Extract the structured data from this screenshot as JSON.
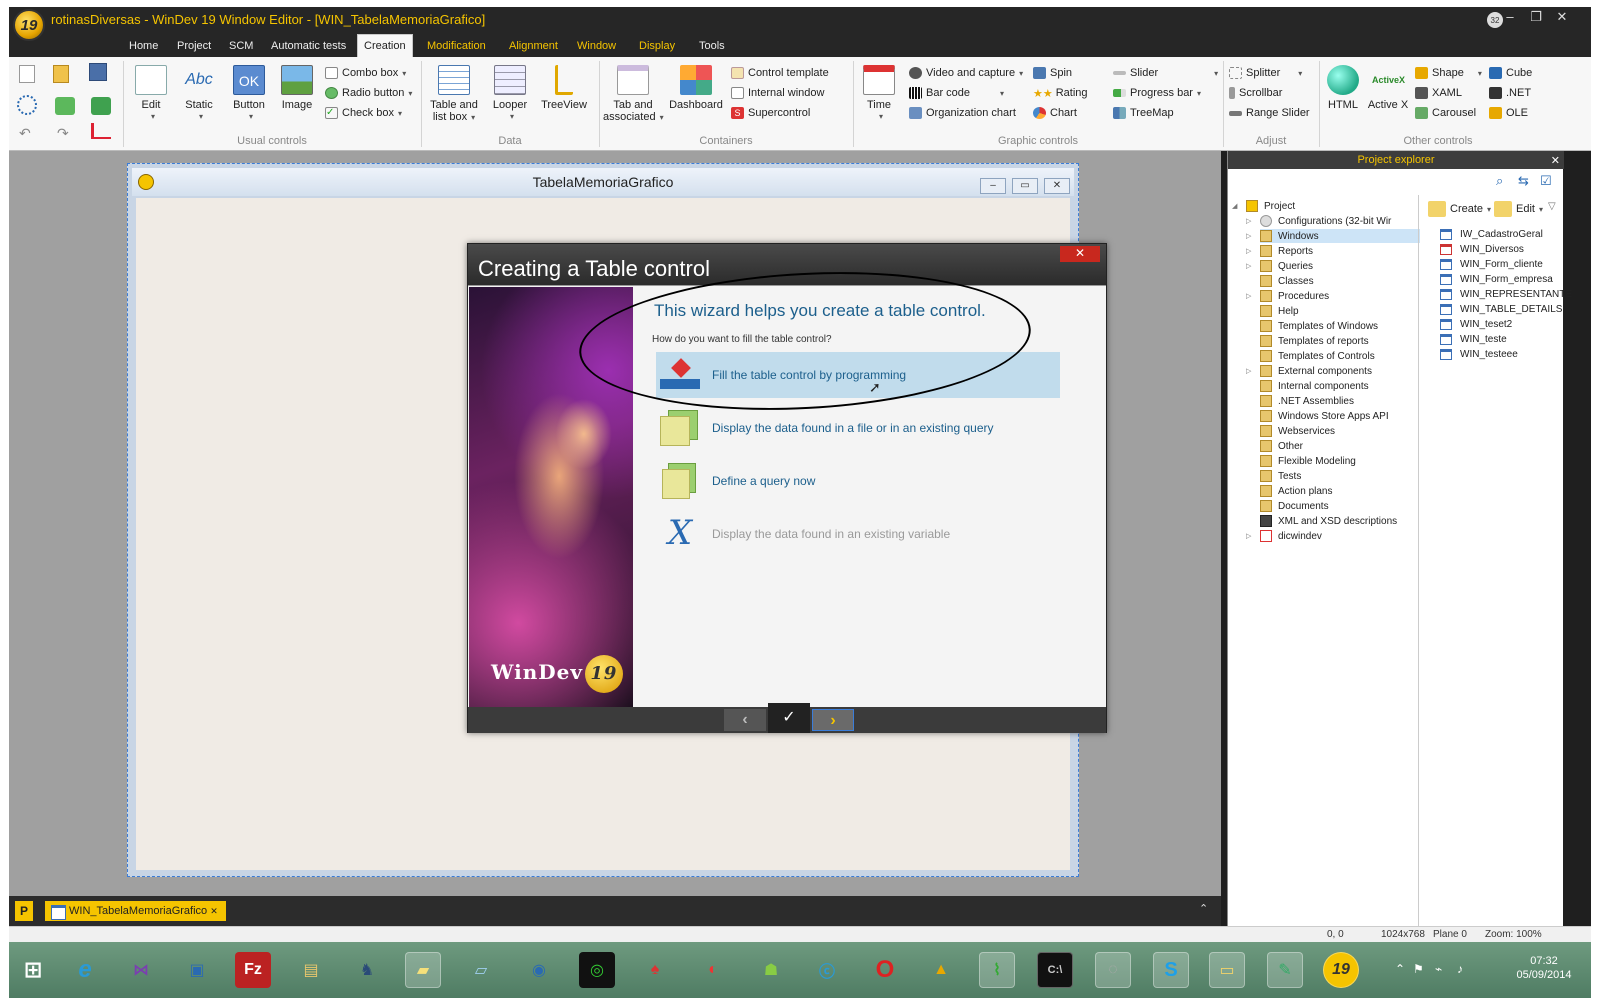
{
  "window": {
    "title": "rotinasDiversas - WinDev 19  Window Editor - [WIN_TabelaMemoriaGrafico]",
    "logo_text": "19",
    "badge": "32"
  },
  "menu": {
    "tabs": [
      "Home",
      "Project",
      "SCM",
      "Automatic tests",
      "Creation",
      "Modification",
      "Alignment",
      "Window",
      "Display",
      "Tools"
    ],
    "active": "Creation"
  },
  "ribbon": {
    "usual": {
      "label": "Usual controls",
      "edit": "Edit",
      "static": "Static",
      "button": "Button",
      "image": "Image",
      "combo": "Combo box",
      "radio": "Radio button",
      "check": "Check box",
      "static_icon_text": "Abc",
      "button_icon_text": "OK"
    },
    "data": {
      "label": "Data",
      "table_1": "Table and",
      "table_2": "list box",
      "looper": "Looper",
      "treeview": "TreeView"
    },
    "containers": {
      "label": "Containers",
      "tab_1": "Tab and",
      "tab_2": "associated",
      "dashboard": "Dashboard",
      "control_template": "Control template",
      "internal_window": "Internal window",
      "supercontrol": "Supercontrol"
    },
    "graphic": {
      "label": "Graphic controls",
      "time": "Time",
      "video": "Video and capture",
      "barcode": "Bar code",
      "org": "Organization chart",
      "spin": "Spin",
      "rating": "Rating",
      "chart": "Chart",
      "slider": "Slider",
      "progress": "Progress bar",
      "treemap": "TreeMap"
    },
    "adjust": {
      "label": "Adjust",
      "splitter": "Splitter",
      "scrollbar": "Scrollbar",
      "range": "Range Slider"
    },
    "other": {
      "label": "Other controls",
      "html": "HTML",
      "activex": "Active X",
      "activex_icon_text": "ActiveX",
      "shape": "Shape",
      "xaml": "XAML",
      "carousel": "Carousel",
      "cube": "Cube",
      "net": ".NET",
      "ole": "OLE"
    }
  },
  "design_window": {
    "title": "TabelaMemoriaGrafico"
  },
  "wizard": {
    "title": "Creating a Table control",
    "heading": "This wizard helps you create a table control.",
    "question": "How do you want to fill the table control?",
    "options": [
      {
        "label": "Fill the table control by programming",
        "selected": true
      },
      {
        "label": "Display the data found in a file or in an existing query",
        "selected": false
      },
      {
        "label": "Define a query now",
        "selected": false
      },
      {
        "label": "Display the data found in an existing variable",
        "selected": false,
        "disabled": true
      }
    ],
    "logo_text": "WinDev",
    "logo_number": "19",
    "back": "‹",
    "finish": "✓",
    "next": "›"
  },
  "explorer": {
    "title": "Project explorer",
    "tree": [
      "Project",
      "Configurations (32-bit Wir",
      "Windows",
      "Reports",
      "Queries",
      "Classes",
      "Procedures",
      "Help",
      "Templates of Windows",
      "Templates of reports",
      "Templates of Controls",
      "External components",
      "Internal components",
      ".NET Assemblies",
      "Windows Store Apps API",
      "Webservices",
      "Other",
      "Flexible Modeling",
      "Tests",
      "Action plans",
      "Documents",
      "XML and XSD descriptions",
      "dicwindev"
    ],
    "create": "Create",
    "edit": "Edit",
    "windows": [
      "IW_CadastroGeral",
      "WIN_Diversos",
      "WIN_Form_cliente",
      "WIN_Form_empresa",
      "WIN_REPRESENTANTE",
      "WIN_TABLE_DETAILS",
      "WIN_teset2",
      "WIN_teste",
      "WIN_testeee"
    ]
  },
  "docbar": {
    "tab": "WIN_TabelaMemoriaGrafico",
    "p_label": "P"
  },
  "status": {
    "coords": "0, 0",
    "resolution": "1024x768",
    "plane": "Plane 0",
    "zoom": "Zoom: 100%"
  },
  "taskbar": {
    "time": "07:32",
    "date": "05/09/2014"
  },
  "colors": {
    "accent": "#f5c400",
    "wizard_text": "#1c5f8c",
    "selection": "#c1dcec",
    "close": "#c8281e"
  }
}
